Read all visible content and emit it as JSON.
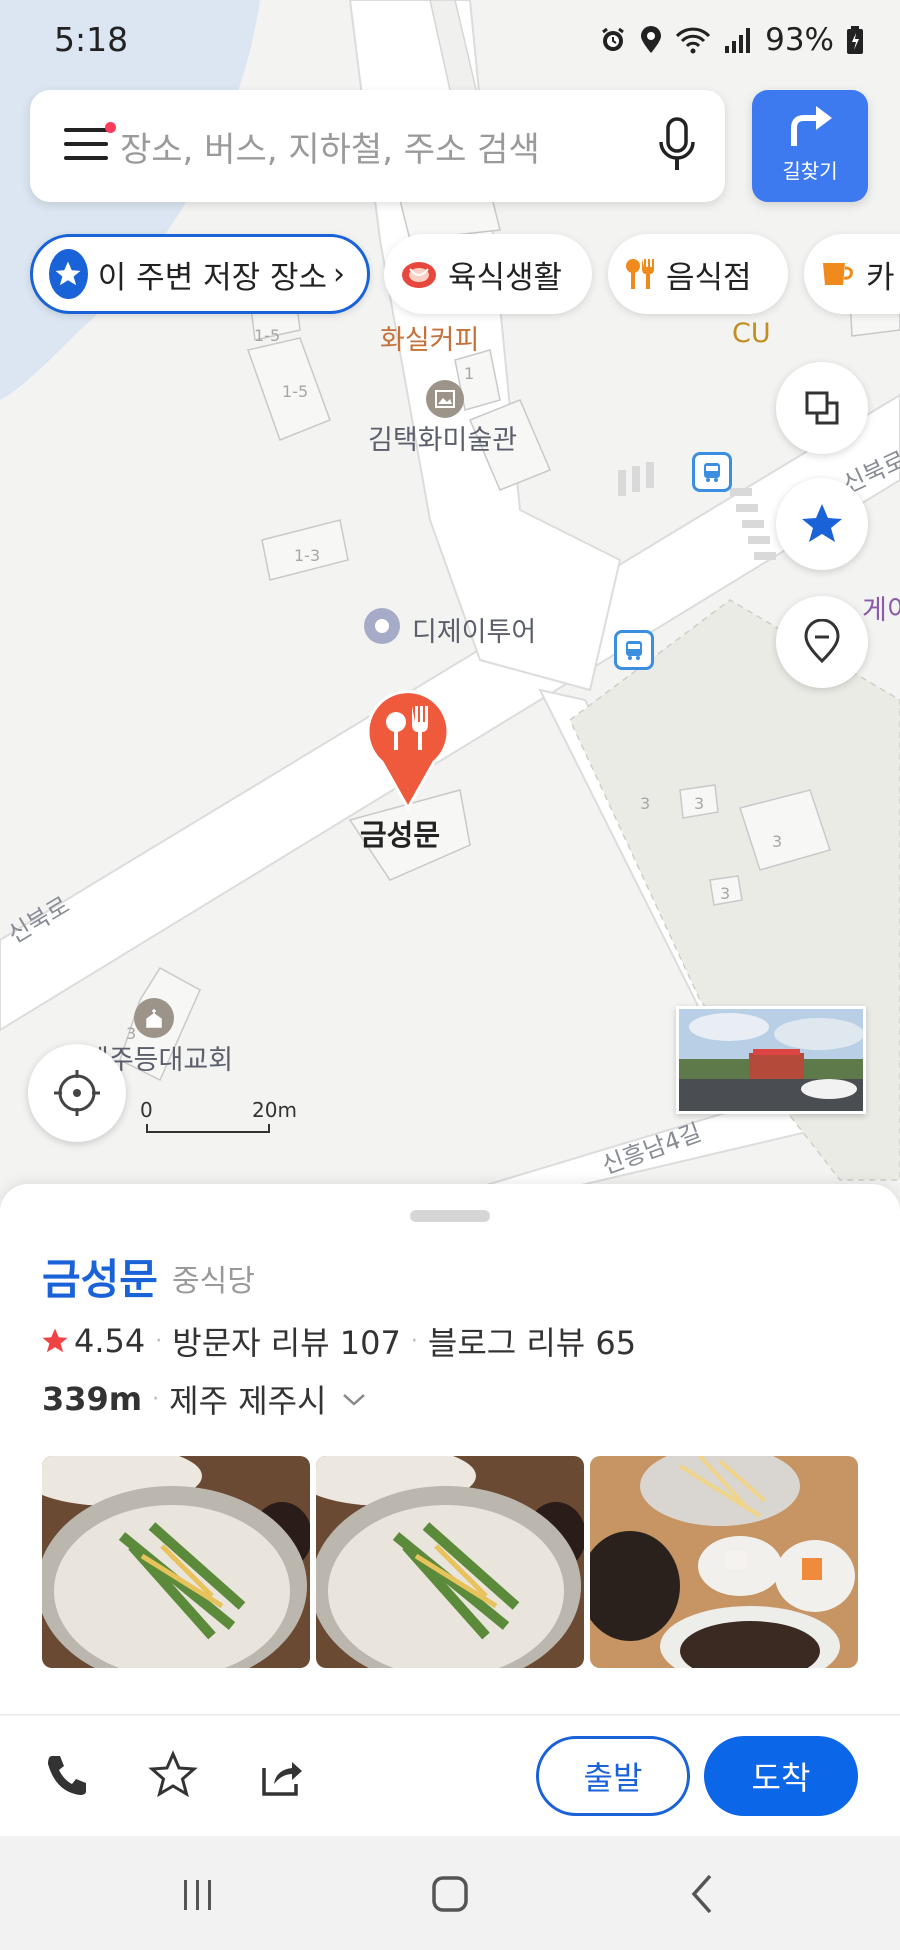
{
  "status_bar": {
    "time": "5:18",
    "battery": "93%",
    "icons": [
      "alarm-icon",
      "location-icon",
      "wifi-icon",
      "signal-icon",
      "battery-icon"
    ]
  },
  "search": {
    "placeholder": "장소, 버스, 지하철, 주소 검색",
    "route_label": "길찾기"
  },
  "chips": [
    {
      "label": "이 주변 저장 장소",
      "icon": "star-icon"
    },
    {
      "label": "육식생활",
      "icon": "meat-icon"
    },
    {
      "label": "음식점",
      "icon": "restaurant-icon"
    },
    {
      "label": "카",
      "icon": "cafe-icon"
    }
  ],
  "map": {
    "labels": {
      "cafe": "화실커피",
      "cu": "CU",
      "museum": "김택화미술관",
      "tour": "디제이투어",
      "church": "제주등대교회",
      "gate": "게이",
      "road_sinbuk": "신북로",
      "road_sinbuk_right": "신북로",
      "road_sinheung": "신흥남4길"
    },
    "building_numbers": [
      "1-5",
      "1-5",
      "1",
      "1-3",
      "3",
      "3",
      "3",
      "3",
      "3"
    ],
    "marker_label": "금성문",
    "scale": {
      "zero": "0",
      "max": "20m"
    }
  },
  "place": {
    "name": "금성문",
    "category": "중식당",
    "rating": "4.54",
    "visitor_reviews": "방문자 리뷰 107",
    "blog_reviews": "블로그 리뷰 65",
    "distance": "339m",
    "region": "제주 제주시"
  },
  "actions": {
    "start_label": "출발",
    "arrive_label": "도착"
  },
  "colors": {
    "accent": "#1a62d8",
    "route_button": "#3d79ef",
    "marker": "#ef5a3c",
    "star": "#f04444"
  }
}
